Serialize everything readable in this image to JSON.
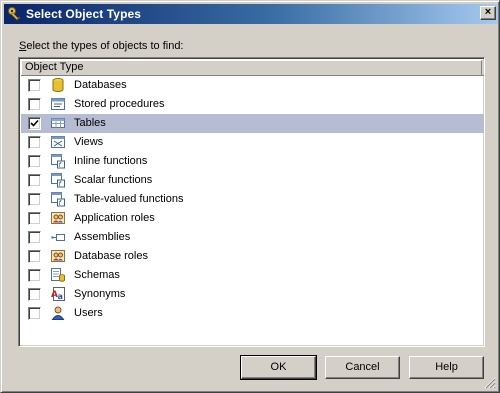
{
  "window": {
    "title": "Select Object Types",
    "close_symbol": "×"
  },
  "instruction": {
    "prefix": "S",
    "rest": "elect the types of objects to find:"
  },
  "list": {
    "column_header": "Object Type",
    "items": [
      {
        "label": "Databases",
        "icon": "database-icon",
        "checked": false
      },
      {
        "label": "Stored procedures",
        "icon": "stored-procedure-icon",
        "checked": false
      },
      {
        "label": "Tables",
        "icon": "table-icon",
        "checked": true,
        "selected": true
      },
      {
        "label": "Views",
        "icon": "view-icon",
        "checked": false
      },
      {
        "label": "Inline functions",
        "icon": "function-icon",
        "checked": false
      },
      {
        "label": "Scalar functions",
        "icon": "function-icon",
        "checked": false
      },
      {
        "label": "Table-valued functions",
        "icon": "function-icon",
        "checked": false
      },
      {
        "label": "Application roles",
        "icon": "role-icon",
        "checked": false
      },
      {
        "label": "Assemblies",
        "icon": "assembly-icon",
        "checked": false
      },
      {
        "label": "Database roles",
        "icon": "role-icon",
        "checked": false
      },
      {
        "label": "Schemas",
        "icon": "schema-icon",
        "checked": false
      },
      {
        "label": "Synonyms",
        "icon": "synonym-icon",
        "checked": false
      },
      {
        "label": "Users",
        "icon": "user-icon",
        "checked": false
      }
    ]
  },
  "buttons": {
    "ok": "OK",
    "cancel": "Cancel",
    "help": "Help"
  },
  "colors": {
    "title_start": "#0a246a",
    "title_end": "#a6caf0",
    "selection": "#b6bdd2",
    "face": "#d4d0c8"
  }
}
